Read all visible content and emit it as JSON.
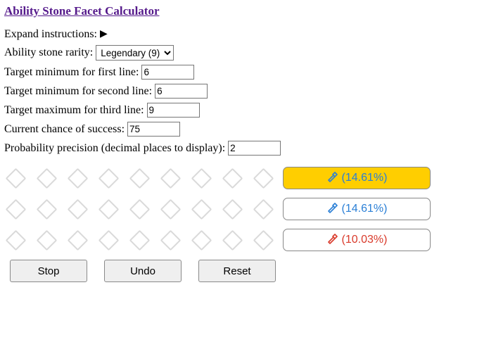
{
  "title": "Ability Stone Facet Calculator",
  "expand": {
    "label": "Expand instructions:"
  },
  "rarity": {
    "label": "Ability stone rarity:",
    "value": "Legendary (9)"
  },
  "target1": {
    "label": "Target minimum for first line:",
    "value": "6"
  },
  "target2": {
    "label": "Target minimum for second line:",
    "value": "6"
  },
  "target3": {
    "label": "Target maximum for third line:",
    "value": "9"
  },
  "chance": {
    "label": "Current chance of success:",
    "value": "75"
  },
  "precision": {
    "label": "Probability precision (decimal places to display):",
    "value": "2"
  },
  "facet": {
    "row1": {
      "pct": "(14.61%)"
    },
    "row2": {
      "pct": "(14.61%)"
    },
    "row3": {
      "pct": "(10.03%)"
    }
  },
  "actions": {
    "stop": "Stop",
    "undo": "Undo",
    "reset": "Reset"
  }
}
